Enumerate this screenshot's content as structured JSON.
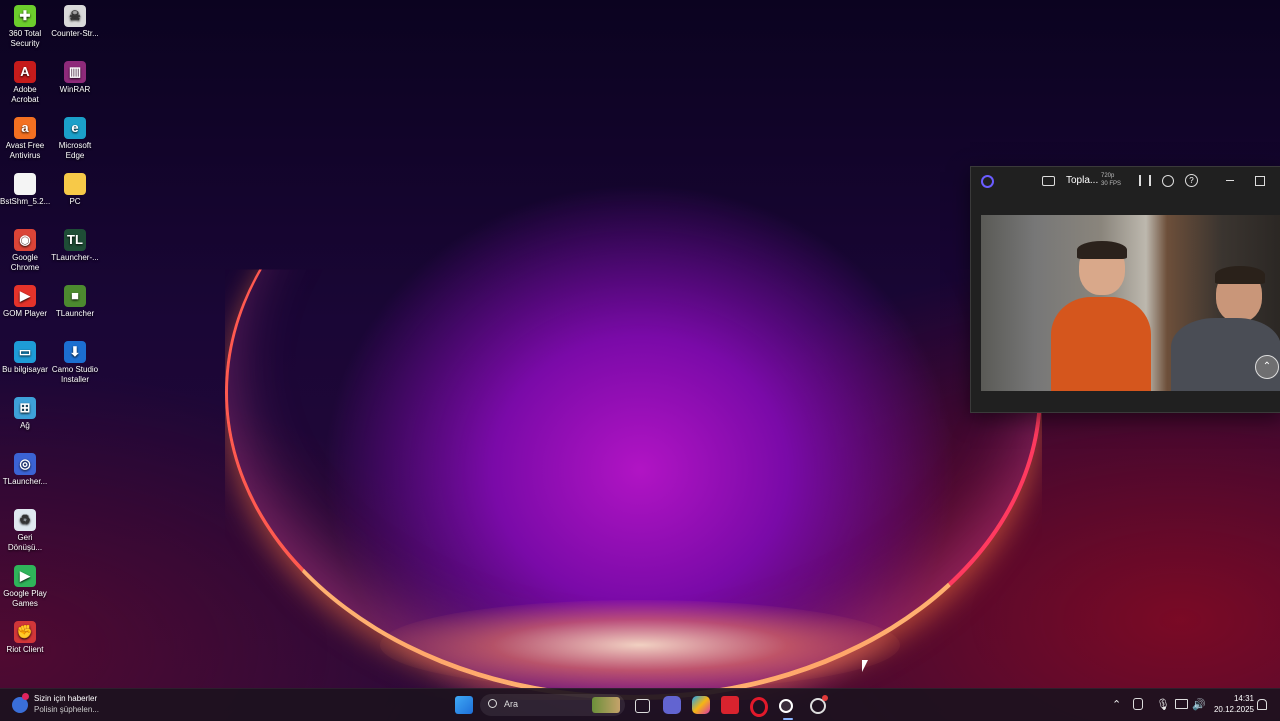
{
  "desktop": {
    "icons_col1": [
      {
        "label": "360 Total Security",
        "icon": "360-security-icon",
        "color": "#6ccd2c",
        "glyph": "✚"
      },
      {
        "label": "Adobe Acrobat",
        "icon": "adobe-acrobat-icon",
        "color": "#c61b1b",
        "glyph": "A"
      },
      {
        "label": "Avast Free Antivirus",
        "icon": "avast-icon",
        "color": "#f37021",
        "glyph": "a"
      },
      {
        "label": "BstShm_5.2...",
        "icon": "file-icon",
        "color": "#f4f4f4",
        "glyph": ""
      },
      {
        "label": "Google Chrome",
        "icon": "chrome-icon",
        "color": "#db4437",
        "glyph": "◉"
      },
      {
        "label": "GOM Player",
        "icon": "gom-player-icon",
        "color": "#e5332a",
        "glyph": "▶"
      },
      {
        "label": "Bu bilgisayar",
        "icon": "this-pc-icon",
        "color": "#1e9bd7",
        "glyph": "▭"
      },
      {
        "label": "Ağ",
        "icon": "network-icon",
        "color": "#3ea1d9",
        "glyph": "⊞"
      },
      {
        "label": "TLauncher...",
        "icon": "tlauncher-blue-icon",
        "color": "#3b63d4",
        "glyph": "◎"
      },
      {
        "label": "Geri Dönüşü...",
        "icon": "recycle-bin-icon",
        "color": "#dfe8ef",
        "glyph": "♻"
      },
      {
        "label": "Google Play Games",
        "icon": "google-play-games-icon",
        "color": "#2fb45a",
        "glyph": "▶"
      },
      {
        "label": "Riot Client",
        "icon": "riot-client-icon",
        "color": "#d13639",
        "glyph": "✊"
      }
    ],
    "icons_col2": [
      {
        "label": "Counter-Str...",
        "icon": "counter-strike-icon",
        "color": "#d9d9d9",
        "glyph": "☠"
      },
      {
        "label": "WinRAR",
        "icon": "winrar-icon",
        "color": "#8e2a7a",
        "glyph": "▥"
      },
      {
        "label": "Microsoft Edge",
        "icon": "edge-icon",
        "color": "#1ba0c9",
        "glyph": "e"
      },
      {
        "label": "PC",
        "icon": "folder-icon",
        "color": "#f7c948",
        "glyph": ""
      },
      {
        "label": "TLauncher-...",
        "icon": "tlauncher-icon",
        "color": "#1e4d36",
        "glyph": "TL"
      },
      {
        "label": "TLauncher",
        "icon": "tlauncher-block-icon",
        "color": "#4c8a2f",
        "glyph": "■"
      },
      {
        "label": "Camo Studio Installer",
        "icon": "camo-installer-icon",
        "color": "#1c6fd1",
        "glyph": "⬇"
      }
    ]
  },
  "camo_window": {
    "title": "Topla...",
    "resolution": "720p",
    "fps": "30 FPS",
    "accent": "#6a5cff"
  },
  "taskbar": {
    "news_title": "Sizin için haberler",
    "news_subtitle": "Polisin şüphelen...",
    "search_placeholder": "Ara",
    "time": "14:31",
    "date": "20.12.2025"
  }
}
